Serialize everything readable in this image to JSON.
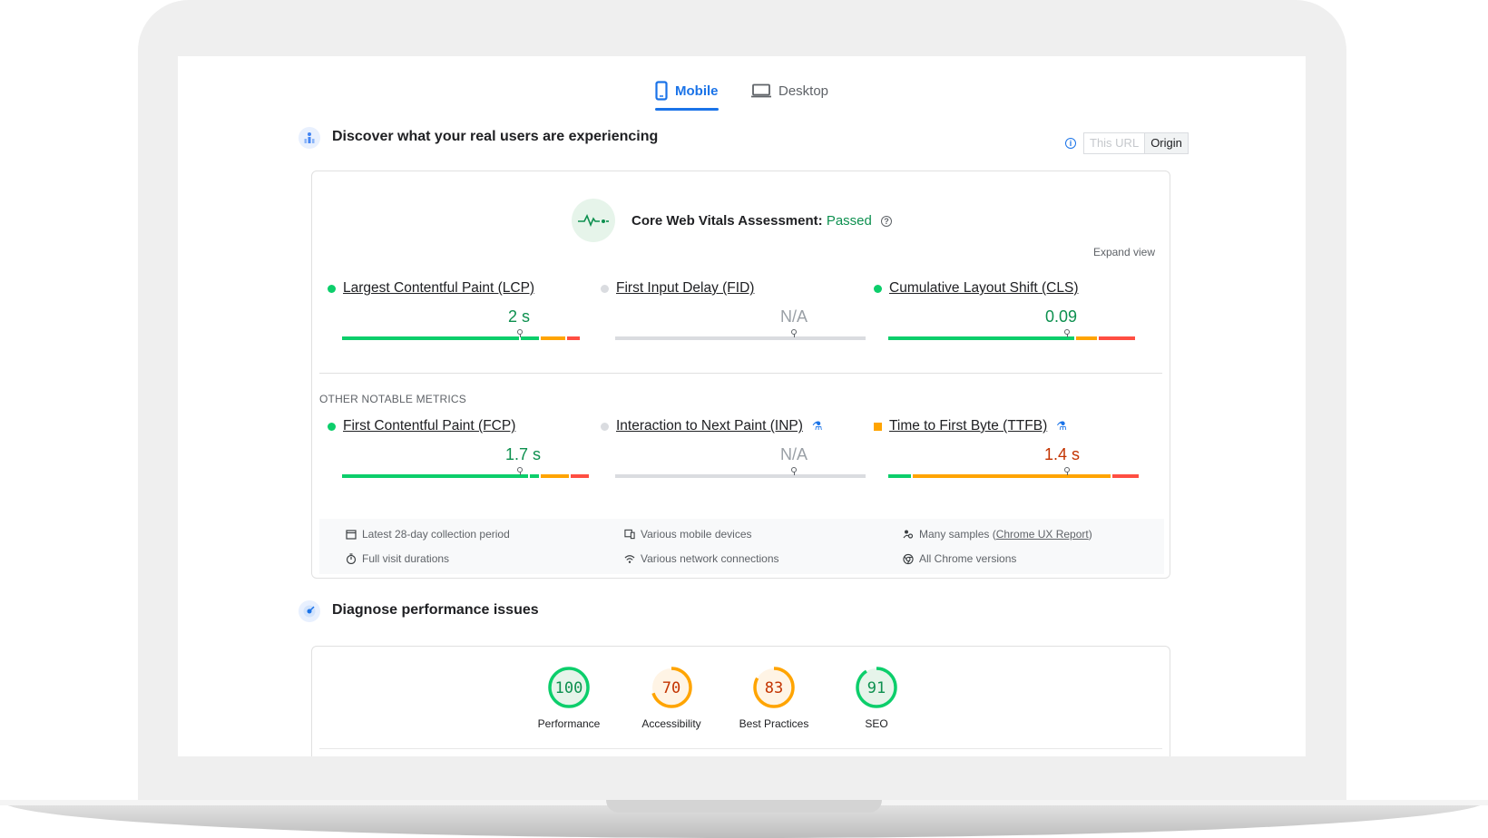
{
  "tabs": {
    "mobile": "Mobile",
    "desktop": "Desktop"
  },
  "field": {
    "title": "Discover what your real users are experiencing",
    "toggle": {
      "this_url": "This URL",
      "origin": "Origin"
    },
    "assessment": {
      "label": "Core Web Vitals Assessment:",
      "status": "Passed"
    },
    "expand": "Expand view",
    "core_metrics": [
      {
        "name": "Largest Contentful Paint (LCP)",
        "value": "2 s",
        "status": "good"
      },
      {
        "name": "First Input Delay (FID)",
        "value": "N/A",
        "status": "none"
      },
      {
        "name": "Cumulative Layout Shift (CLS)",
        "value": "0.09",
        "status": "good"
      }
    ],
    "other_label": "OTHER NOTABLE METRICS",
    "other_metrics": [
      {
        "name": "First Contentful Paint (FCP)",
        "value": "1.7 s",
        "status": "good"
      },
      {
        "name": "Interaction to Next Paint (INP)",
        "value": "N/A",
        "status": "none",
        "experimental": true
      },
      {
        "name": "Time to First Byte (TTFB)",
        "value": "1.4 s",
        "status": "average",
        "experimental": true
      }
    ],
    "meta": {
      "period": "Latest 28-day collection period",
      "devices": "Various mobile devices",
      "samples_prefix": "Many samples (",
      "samples_link": "Chrome UX Report",
      "samples_suffix": ")",
      "durations": "Full visit durations",
      "network": "Various network connections",
      "versions": "All Chrome versions"
    }
  },
  "lab": {
    "title": "Diagnose performance issues",
    "scores": [
      {
        "label": "Performance",
        "value": "100",
        "score": 100,
        "color": "#0cce6b",
        "text_color": "#0d904f",
        "bg": "#e6f4ea"
      },
      {
        "label": "Accessibility",
        "value": "70",
        "score": 70,
        "color": "#ffa400",
        "text_color": "#c33300",
        "bg": "#fff4e5"
      },
      {
        "label": "Best Practices",
        "value": "83",
        "score": 83,
        "color": "#ffa400",
        "text_color": "#c33300",
        "bg": "#fff4e5"
      },
      {
        "label": "SEO",
        "value": "91",
        "score": 91,
        "color": "#0cce6b",
        "text_color": "#0d904f",
        "bg": "#e6f4ea"
      }
    ]
  },
  "colors": {
    "accent": "#1a73e8",
    "good": "#0cce6b",
    "average": "#ffa400",
    "poor": "#ff4e42",
    "na": "#dadce0"
  }
}
